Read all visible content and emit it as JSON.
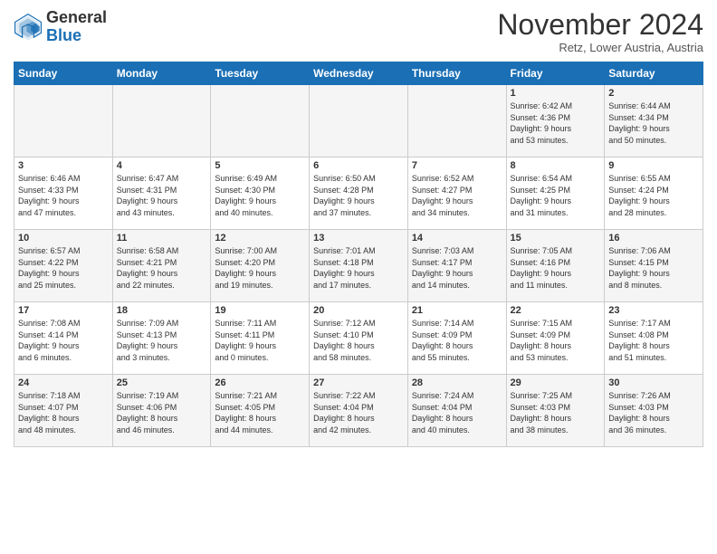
{
  "logo": {
    "line1": "General",
    "line2": "Blue"
  },
  "title": "November 2024",
  "subtitle": "Retz, Lower Austria, Austria",
  "days_of_week": [
    "Sunday",
    "Monday",
    "Tuesday",
    "Wednesday",
    "Thursday",
    "Friday",
    "Saturday"
  ],
  "weeks": [
    [
      {
        "day": "",
        "info": ""
      },
      {
        "day": "",
        "info": ""
      },
      {
        "day": "",
        "info": ""
      },
      {
        "day": "",
        "info": ""
      },
      {
        "day": "",
        "info": ""
      },
      {
        "day": "1",
        "info": "Sunrise: 6:42 AM\nSunset: 4:36 PM\nDaylight: 9 hours\nand 53 minutes."
      },
      {
        "day": "2",
        "info": "Sunrise: 6:44 AM\nSunset: 4:34 PM\nDaylight: 9 hours\nand 50 minutes."
      }
    ],
    [
      {
        "day": "3",
        "info": "Sunrise: 6:46 AM\nSunset: 4:33 PM\nDaylight: 9 hours\nand 47 minutes."
      },
      {
        "day": "4",
        "info": "Sunrise: 6:47 AM\nSunset: 4:31 PM\nDaylight: 9 hours\nand 43 minutes."
      },
      {
        "day": "5",
        "info": "Sunrise: 6:49 AM\nSunset: 4:30 PM\nDaylight: 9 hours\nand 40 minutes."
      },
      {
        "day": "6",
        "info": "Sunrise: 6:50 AM\nSunset: 4:28 PM\nDaylight: 9 hours\nand 37 minutes."
      },
      {
        "day": "7",
        "info": "Sunrise: 6:52 AM\nSunset: 4:27 PM\nDaylight: 9 hours\nand 34 minutes."
      },
      {
        "day": "8",
        "info": "Sunrise: 6:54 AM\nSunset: 4:25 PM\nDaylight: 9 hours\nand 31 minutes."
      },
      {
        "day": "9",
        "info": "Sunrise: 6:55 AM\nSunset: 4:24 PM\nDaylight: 9 hours\nand 28 minutes."
      }
    ],
    [
      {
        "day": "10",
        "info": "Sunrise: 6:57 AM\nSunset: 4:22 PM\nDaylight: 9 hours\nand 25 minutes."
      },
      {
        "day": "11",
        "info": "Sunrise: 6:58 AM\nSunset: 4:21 PM\nDaylight: 9 hours\nand 22 minutes."
      },
      {
        "day": "12",
        "info": "Sunrise: 7:00 AM\nSunset: 4:20 PM\nDaylight: 9 hours\nand 19 minutes."
      },
      {
        "day": "13",
        "info": "Sunrise: 7:01 AM\nSunset: 4:18 PM\nDaylight: 9 hours\nand 17 minutes."
      },
      {
        "day": "14",
        "info": "Sunrise: 7:03 AM\nSunset: 4:17 PM\nDaylight: 9 hours\nand 14 minutes."
      },
      {
        "day": "15",
        "info": "Sunrise: 7:05 AM\nSunset: 4:16 PM\nDaylight: 9 hours\nand 11 minutes."
      },
      {
        "day": "16",
        "info": "Sunrise: 7:06 AM\nSunset: 4:15 PM\nDaylight: 9 hours\nand 8 minutes."
      }
    ],
    [
      {
        "day": "17",
        "info": "Sunrise: 7:08 AM\nSunset: 4:14 PM\nDaylight: 9 hours\nand 6 minutes."
      },
      {
        "day": "18",
        "info": "Sunrise: 7:09 AM\nSunset: 4:13 PM\nDaylight: 9 hours\nand 3 minutes."
      },
      {
        "day": "19",
        "info": "Sunrise: 7:11 AM\nSunset: 4:11 PM\nDaylight: 9 hours\nand 0 minutes."
      },
      {
        "day": "20",
        "info": "Sunrise: 7:12 AM\nSunset: 4:10 PM\nDaylight: 8 hours\nand 58 minutes."
      },
      {
        "day": "21",
        "info": "Sunrise: 7:14 AM\nSunset: 4:09 PM\nDaylight: 8 hours\nand 55 minutes."
      },
      {
        "day": "22",
        "info": "Sunrise: 7:15 AM\nSunset: 4:09 PM\nDaylight: 8 hours\nand 53 minutes."
      },
      {
        "day": "23",
        "info": "Sunrise: 7:17 AM\nSunset: 4:08 PM\nDaylight: 8 hours\nand 51 minutes."
      }
    ],
    [
      {
        "day": "24",
        "info": "Sunrise: 7:18 AM\nSunset: 4:07 PM\nDaylight: 8 hours\nand 48 minutes."
      },
      {
        "day": "25",
        "info": "Sunrise: 7:19 AM\nSunset: 4:06 PM\nDaylight: 8 hours\nand 46 minutes."
      },
      {
        "day": "26",
        "info": "Sunrise: 7:21 AM\nSunset: 4:05 PM\nDaylight: 8 hours\nand 44 minutes."
      },
      {
        "day": "27",
        "info": "Sunrise: 7:22 AM\nSunset: 4:04 PM\nDaylight: 8 hours\nand 42 minutes."
      },
      {
        "day": "28",
        "info": "Sunrise: 7:24 AM\nSunset: 4:04 PM\nDaylight: 8 hours\nand 40 minutes."
      },
      {
        "day": "29",
        "info": "Sunrise: 7:25 AM\nSunset: 4:03 PM\nDaylight: 8 hours\nand 38 minutes."
      },
      {
        "day": "30",
        "info": "Sunrise: 7:26 AM\nSunset: 4:03 PM\nDaylight: 8 hours\nand 36 minutes."
      }
    ]
  ]
}
